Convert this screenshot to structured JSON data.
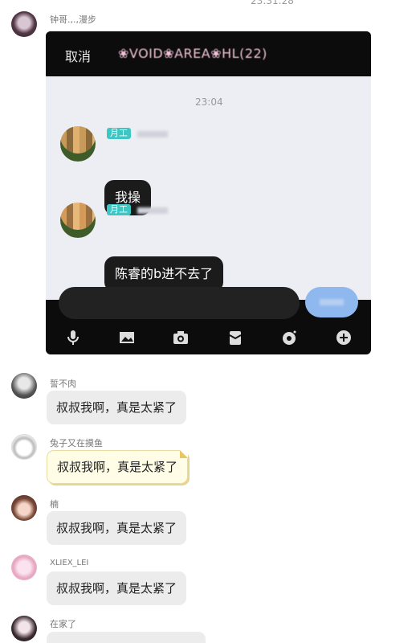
{
  "top_time": "23:31:28",
  "post": {
    "sender": "钟哥.,.,漫步"
  },
  "screenshot": {
    "header": {
      "cancel": "取消",
      "title": "❀VOID❀AREA❀HL(22)"
    },
    "time": "23:04",
    "messages": [
      {
        "tag": "月工",
        "text": "我操"
      },
      {
        "tag": "月工",
        "text": "陈睿的b进不去了"
      }
    ],
    "tools": [
      "mic-icon",
      "image-icon",
      "camera-icon",
      "gift-icon",
      "hongbao-icon",
      "plus-icon"
    ]
  },
  "replies": [
    {
      "sender": "誓不肉",
      "text": "叔叔我啊，真是太紧了"
    },
    {
      "sender": "兔子又在摸鱼",
      "text": "叔叔我啊，真是太紧了"
    },
    {
      "sender": "楠",
      "text": "叔叔我啊，真是太紧了"
    },
    {
      "sender": "XLIEX_LEI",
      "text": "叔叔我啊，真是太紧了"
    },
    {
      "sender": "在家了",
      "text": ""
    }
  ]
}
